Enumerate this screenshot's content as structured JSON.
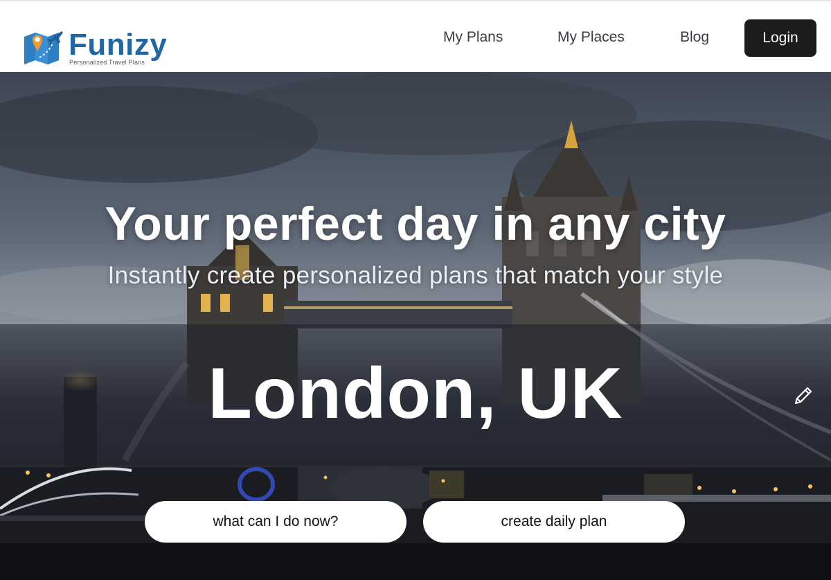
{
  "brand": {
    "name": "Funizy",
    "tagline": "Personalized Travel Plans",
    "logo_icon": "map-pin-airplane-icon",
    "color": "#2166a6"
  },
  "nav": {
    "items": [
      {
        "label": "My Plans"
      },
      {
        "label": "My Places"
      },
      {
        "label": "Blog"
      }
    ],
    "login_label": "Login"
  },
  "hero": {
    "headline": "Your perfect day in any city",
    "subheadline": "Instantly create personalized plans that match your style",
    "city": "London, UK",
    "edit_icon": "pencil-icon",
    "background_image": "tower-bridge-dusk"
  },
  "actions": {
    "now_label": "what can I do now?",
    "plan_label": "create daily plan"
  }
}
